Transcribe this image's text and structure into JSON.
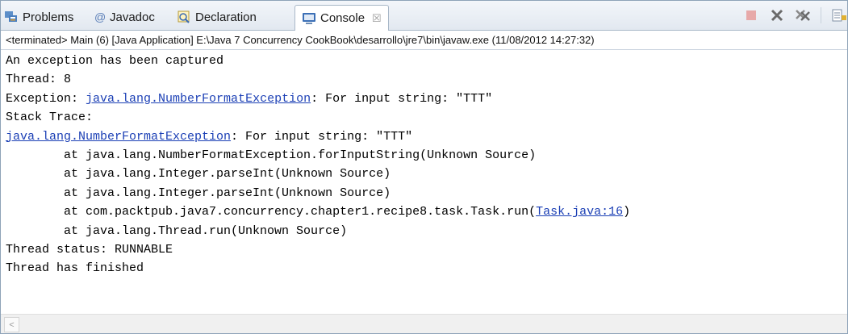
{
  "tabs": [
    {
      "label": "Problems",
      "icon": "problems-icon",
      "active": false
    },
    {
      "label": "Javadoc",
      "icon": "javadoc-icon",
      "active": false
    },
    {
      "label": "Declaration",
      "icon": "declaration-icon",
      "active": false
    },
    {
      "label": "Console",
      "icon": "console-icon",
      "active": true,
      "close": "☒"
    }
  ],
  "toolbar": {
    "icons": [
      "terminate-icon",
      "remove-launch-icon",
      "remove-all-terminated-icon",
      "scroll-lock-icon"
    ]
  },
  "infobar": {
    "text": "<terminated> Main (6) [Java Application] E:\\Java 7 Concurrency CookBook\\desarrollo\\jre7\\bin\\javaw.exe (11/08/2012 14:27:32)"
  },
  "console": {
    "lines": [
      {
        "parts": [
          {
            "text": "An exception has been captured"
          }
        ]
      },
      {
        "parts": [
          {
            "text": "Thread: 8"
          }
        ]
      },
      {
        "parts": [
          {
            "text": "Exception: "
          },
          {
            "text": "java.lang.NumberFormatException",
            "link": true
          },
          {
            "text": ": For input string: \"TTT\""
          }
        ]
      },
      {
        "parts": [
          {
            "text": "Stack Trace:"
          }
        ]
      },
      {
        "parts": [
          {
            "text": "java.lang.NumberFormatException",
            "link": true
          },
          {
            "text": ": For input string: \"TTT\""
          }
        ]
      },
      {
        "parts": [
          {
            "text": "        at java.lang.NumberFormatException.forInputString(Unknown Source)"
          }
        ]
      },
      {
        "parts": [
          {
            "text": "        at java.lang.Integer.parseInt(Unknown Source)"
          }
        ]
      },
      {
        "parts": [
          {
            "text": "        at java.lang.Integer.parseInt(Unknown Source)"
          }
        ]
      },
      {
        "parts": [
          {
            "text": "        at com.packtpub.java7.concurrency.chapter1.recipe8.task.Task.run("
          },
          {
            "text": "Task.java:16",
            "link": true
          },
          {
            "text": ")"
          }
        ]
      },
      {
        "parts": [
          {
            "text": "        at java.lang.Thread.run(Unknown Source)"
          }
        ]
      },
      {
        "parts": [
          {
            "text": "Thread status: RUNNABLE"
          }
        ]
      },
      {
        "parts": [
          {
            "text": "Thread has finished"
          }
        ]
      }
    ]
  },
  "scrollbar": {
    "left_arrow": "<"
  },
  "colors": {
    "link": "#1b3fb5",
    "tab_bar": "#e2e8f0",
    "border": "#8ea3b8"
  }
}
